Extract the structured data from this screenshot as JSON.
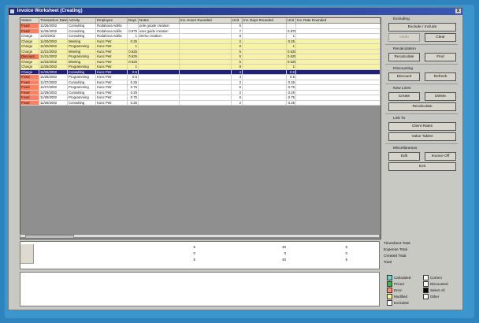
{
  "window": {
    "title": "Invoice Worksheet (Creating)",
    "close_label": "x"
  },
  "colors": {
    "status_red": "#ff8060",
    "status_orange": "#f47b52",
    "row_yellow": "#f7f2a4",
    "selected_blue": "#22217a",
    "grid_empty": "#8f8f8f",
    "legend_calculated": "#74d0c4",
    "legend_priced": "#3fb257",
    "legend_error": "#ff8f6e",
    "legend_modified": "#f7f2a4",
    "legend_select_all": "#000000"
  },
  "grid": {
    "columns": [
      "Status",
      "Transaction Date",
      "Activity",
      "Employee",
      "Days",
      "Notes",
      "Inv. Hours Rounded",
      "Unit",
      "Inv. Days Rounded",
      "Unit",
      "Inv. Rate Rounded"
    ],
    "rows": [
      {
        "style": "red",
        "cells": [
          "Fixed",
          "11/26/2002",
          "Consulting",
          "Rodahova Adéla",
          "",
          "pole goode creation",
          "",
          "5",
          "",
          "",
          ""
        ]
      },
      {
        "style": "red",
        "cells": [
          "Fixed",
          "11/26/2002",
          "Consulting",
          "Rodahova Adéla",
          "0.875",
          "user guide creation",
          "",
          "7",
          "",
          "0.875",
          ""
        ]
      },
      {
        "style": "white",
        "cells": [
          "Charge",
          "12/3/2002",
          "Consulting",
          "Rodahova Adéla",
          "1",
          "Demo creation",
          "",
          "8",
          "",
          "1",
          ""
        ]
      },
      {
        "style": "yellow",
        "cells": [
          "Charge",
          "11/20/2002",
          "Meeting",
          "Kunc Petr",
          "0.25",
          "",
          "",
          "2",
          "",
          "0.25",
          ""
        ]
      },
      {
        "style": "yellow",
        "cells": [
          "Charge",
          "11/20/2002",
          "Programming",
          "Kunc Petr",
          "1",
          "",
          "",
          "8",
          "",
          "1",
          ""
        ]
      },
      {
        "style": "yellow",
        "cells": [
          "Charge",
          "11/21/2002",
          "Meeting",
          "Kunc Petr",
          "0.625",
          "",
          "",
          "5",
          "",
          "0.625",
          ""
        ]
      },
      {
        "style": "yellow",
        "cells": [
          "Discount",
          "11/21/2002",
          "Programming",
          "Kunc Petr",
          "0.625",
          "",
          "",
          "5",
          "",
          "0.625",
          ""
        ]
      },
      {
        "style": "yellow",
        "cells": [
          "Charge",
          "11/22/2002",
          "Meeting",
          "Kunc Petr",
          "0.625",
          "",
          "",
          "5",
          "",
          "0.625",
          ""
        ]
      },
      {
        "style": "yellow",
        "cells": [
          "Charge",
          "11/25/2002",
          "Programming",
          "Kunc Petr",
          "1",
          "",
          "",
          "8",
          "",
          "1",
          ""
        ]
      },
      {
        "style": "selected",
        "cells": [
          "Charge",
          "11/26/2002",
          "Consulting",
          "Kunc Petr",
          "0.5",
          "",
          "",
          "4",
          "",
          "0.5",
          ""
        ]
      },
      {
        "style": "red",
        "cells": [
          "Fixed",
          "11/26/2002",
          "Programming",
          "Kunc Petr",
          "0.5",
          "",
          "",
          "4",
          "",
          "0.5",
          ""
        ]
      },
      {
        "style": "red",
        "cells": [
          "Fixed",
          "11/27/2002",
          "Consulting",
          "Kunc Petr",
          "0.25",
          "",
          "",
          "2",
          "",
          "0.25",
          ""
        ]
      },
      {
        "style": "red",
        "cells": [
          "Fixed",
          "11/27/2002",
          "Programming",
          "Kunc Petr",
          "0.75",
          "",
          "",
          "6",
          "",
          "0.75",
          ""
        ]
      },
      {
        "style": "red",
        "cells": [
          "Fixed",
          "11/28/2002",
          "Consulting",
          "Kunc Petr",
          "0.25",
          "",
          "",
          "2",
          "",
          "0.25",
          ""
        ]
      },
      {
        "style": "red",
        "cells": [
          "Fixed",
          "11/28/2002",
          "Programming",
          "Kunc Petr",
          "0.75",
          "",
          "",
          "6",
          "",
          "0.75",
          ""
        ]
      },
      {
        "style": "red",
        "cells": [
          "Fixed",
          "11/29/2002",
          "Consulting",
          "Kunc Petr",
          "0.25",
          "",
          "",
          "2",
          "",
          "0.25",
          ""
        ]
      }
    ]
  },
  "totals": {
    "rows": [
      [
        "5",
        "40",
        "5"
      ],
      [
        "0",
        "0",
        "0"
      ],
      [
        "5",
        "40",
        "5"
      ]
    ]
  },
  "right_panel": {
    "excluding": {
      "title": "Excluding",
      "exclude_label": "Exclude / Include",
      "undo_label": "Undo",
      "clear_label": "Clear"
    },
    "recalculation": {
      "title": "Recalculation",
      "recalculate_label": "Recalculate",
      "find_label": "Find"
    },
    "discounting": {
      "title": "Discounting",
      "discount_label": "Discount",
      "refresh_label": "Refresh"
    },
    "new_lines": {
      "title": "New Lines",
      "create_label": "Create",
      "delete_label": "Delete",
      "recalculate_label": "Recalculate"
    },
    "link_to": {
      "title": "Link To",
      "client_rates_label": "Client Rates",
      "value_tables_label": "Value Tables"
    },
    "miscellaneous": {
      "title": "Miscellaneous",
      "edit_label": "Edit",
      "invoice_off_label": "Invoice Off",
      "exit_label": "Exit"
    }
  },
  "total_labels": [
    "Timesheet Total",
    "Expense Total",
    "Created Total",
    "Total"
  ],
  "legend": [
    {
      "label": "Calculated",
      "color": "#74d0c4"
    },
    {
      "label": "Priced",
      "color": "#3fb257"
    },
    {
      "label": "Error",
      "color": "#ff8f6e"
    },
    {
      "label": "Modified",
      "color": "#f7f2a4"
    },
    {
      "label": "Excluded",
      "color": "#ffffff"
    },
    {
      "label": "Correct",
      "color": "#ffffff"
    },
    {
      "label": "Discounted",
      "color": "#ffffff"
    },
    {
      "label": "Select All",
      "color": "#000000"
    },
    {
      "label": "Other",
      "color": "#ffffff"
    }
  ]
}
